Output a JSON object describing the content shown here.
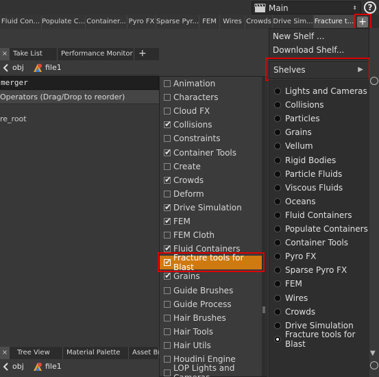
{
  "desk": {
    "name": "Main",
    "help": "?"
  },
  "shelf_tabs": [
    {
      "label": "Fluid Con..."
    },
    {
      "label": "Populate C..."
    },
    {
      "label": "Container..."
    },
    {
      "label": "Pyro FX"
    },
    {
      "label": "Sparse Pyr..."
    },
    {
      "label": "FEM"
    },
    {
      "label": "Wires"
    },
    {
      "label": "Crowds"
    },
    {
      "label": "Drive Sim..."
    },
    {
      "label": "Fracture t..."
    }
  ],
  "shelf_add_label": "+",
  "pane": {
    "tabs": [
      {
        "label": "Take List"
      },
      {
        "label": "Performance Monitor"
      }
    ],
    "add_tab": "+",
    "close": "×",
    "path_obj": "obj",
    "path_file": "file1",
    "search_value": "merger",
    "operators_header": "Operators (Drag/Drop to reorder)",
    "root_item": "re_root"
  },
  "bottom_pane": {
    "tabs": [
      {
        "label": "Tree View"
      },
      {
        "label": "Material Palette"
      },
      {
        "label": "Asset Bro"
      }
    ],
    "close": "×",
    "path_obj": "obj",
    "path_file": "file1"
  },
  "checklist": [
    {
      "label": "Animation",
      "checked": false
    },
    {
      "label": "Characters",
      "checked": false
    },
    {
      "label": "Cloud FX",
      "checked": false
    },
    {
      "label": "Collisions",
      "checked": true
    },
    {
      "label": "Constraints",
      "checked": false
    },
    {
      "label": "Container Tools",
      "checked": true
    },
    {
      "label": "Create",
      "checked": false
    },
    {
      "label": "Crowds",
      "checked": true
    },
    {
      "label": "Deform",
      "checked": false
    },
    {
      "label": "Drive Simulation",
      "checked": true
    },
    {
      "label": "FEM",
      "checked": true
    },
    {
      "label": "FEM Cloth",
      "checked": false
    },
    {
      "label": "Fluid Containers",
      "checked": true
    },
    {
      "label": "Fracture tools for Blast",
      "checked": true,
      "highlight": true
    },
    {
      "label": "Grains",
      "checked": true
    },
    {
      "label": "Guide Brushes",
      "checked": false
    },
    {
      "label": "Guide Process",
      "checked": false
    },
    {
      "label": "Hair Brushes",
      "checked": false
    },
    {
      "label": "Hair Tools",
      "checked": false
    },
    {
      "label": "Hair Utils",
      "checked": false
    },
    {
      "label": "Houdini Engine",
      "checked": false
    },
    {
      "label": "LOP Lights and Cameras",
      "checked": false
    }
  ],
  "shelf_menu": {
    "new_shelf": "New Shelf ...",
    "download_shelf": "Download Shelf...",
    "shelves": "Shelves",
    "shelves_arrow": "▶"
  },
  "shelf_sets": [
    {
      "label": "Lights and Cameras",
      "selected": false
    },
    {
      "label": "Collisions",
      "selected": false
    },
    {
      "label": "Particles",
      "selected": false
    },
    {
      "label": "Grains",
      "selected": false
    },
    {
      "label": "Vellum",
      "selected": false
    },
    {
      "label": "Rigid Bodies",
      "selected": false
    },
    {
      "label": "Particle Fluids",
      "selected": false
    },
    {
      "label": "Viscous Fluids",
      "selected": false
    },
    {
      "label": "Oceans",
      "selected": false
    },
    {
      "label": "Fluid Containers",
      "selected": false
    },
    {
      "label": "Populate Containers",
      "selected": false
    },
    {
      "label": "Container Tools",
      "selected": false
    },
    {
      "label": "Pyro FX",
      "selected": false
    },
    {
      "label": "Sparse Pyro FX",
      "selected": false
    },
    {
      "label": "FEM",
      "selected": false
    },
    {
      "label": "Wires",
      "selected": false
    },
    {
      "label": "Crowds",
      "selected": false
    },
    {
      "label": "Drive Simulation",
      "selected": false
    },
    {
      "label": "Fracture tools for Blast",
      "selected": true
    }
  ],
  "colors": {
    "highlight": "#cf7a10",
    "annotation": "#e20000",
    "background": "#3a3a3a"
  }
}
